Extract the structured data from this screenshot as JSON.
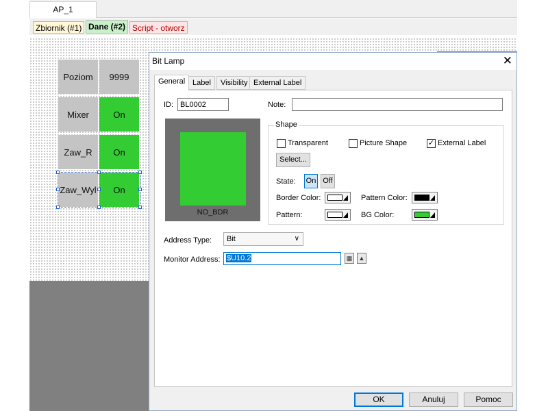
{
  "window_tab": {
    "label": "AP_1"
  },
  "screen_tabs": [
    {
      "label": "Zbiornik (#1)"
    },
    {
      "label": "Dane (#2)"
    },
    {
      "label": "Script - otworz"
    }
  ],
  "canvas": {
    "cells": [
      {
        "name": "Poziom",
        "value": "9999"
      },
      {
        "name": "Mixer",
        "value": "On"
      },
      {
        "name": "Zaw_R",
        "value": "On"
      },
      {
        "name": "Zaw_Wyl",
        "value": "On"
      }
    ]
  },
  "dialog": {
    "title": "Bit Lamp",
    "close_icon": "close-icon",
    "tabs": [
      {
        "label": "General"
      },
      {
        "label": "Label"
      },
      {
        "label": "Visibility"
      },
      {
        "label": "External Label"
      }
    ],
    "id_label": "ID:",
    "id_value": "BL0002",
    "note_label": "Note:",
    "note_value": "",
    "preview_label": "NO_BDR",
    "shape": {
      "legend": "Shape",
      "transparent_label": "Transparent",
      "transparent_checked": false,
      "picture_shape_label": "Picture Shape",
      "picture_shape_checked": false,
      "external_label_label": "External Label",
      "external_label_checked": true,
      "select_button": "Select...",
      "state_label": "State:",
      "state_on": "On",
      "state_off": "Off",
      "border_color_label": "Border Color:",
      "pattern_color_label": "Pattern Color:",
      "pattern_label": "Pattern:",
      "bg_color_label": "BG Color:"
    },
    "address_type_label": "Address Type:",
    "address_type_value": "Bit",
    "monitor_address_label": "Monitor Address:",
    "monitor_address_value": "$U10.2",
    "buttons": {
      "ok": "OK",
      "cancel": "Anuluj",
      "help": "Pomoc"
    }
  },
  "colors": {
    "lamp_green": "#33cc33",
    "cell_gray": "#c4c4c4",
    "border_color": "#ffffff",
    "pattern_color": "#000000",
    "pattern": "#ffffff",
    "bg_color": "#33cc33"
  }
}
